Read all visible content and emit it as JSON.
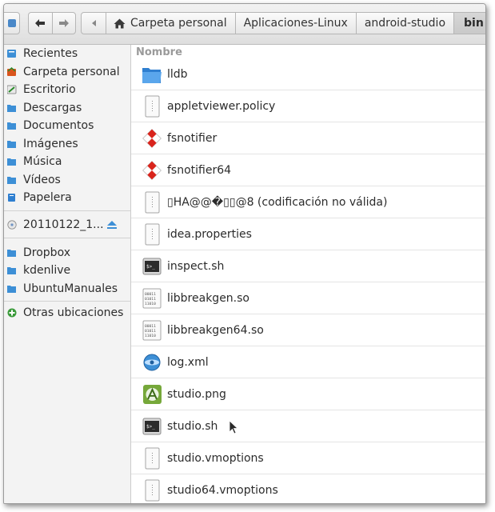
{
  "header": {
    "breadcrumbs": [
      {
        "label": "Carpeta personal",
        "icon": "home-icon"
      },
      {
        "label": "Aplicaciones-Linux"
      },
      {
        "label": "android-studio"
      },
      {
        "label": "bin",
        "active": true
      }
    ]
  },
  "sidebar": {
    "places": [
      {
        "label": "Recientes",
        "icon": "clock-icon"
      },
      {
        "label": "Carpeta personal",
        "icon": "home-icon"
      },
      {
        "label": "Escritorio",
        "icon": "desktop-icon"
      },
      {
        "label": "Descargas",
        "icon": "folder-icon"
      },
      {
        "label": "Documentos",
        "icon": "folder-icon"
      },
      {
        "label": "Imágenes",
        "icon": "folder-icon"
      },
      {
        "label": "Música",
        "icon": "folder-icon"
      },
      {
        "label": "Vídeos",
        "icon": "folder-icon"
      },
      {
        "label": "Papelera",
        "icon": "trash-icon"
      }
    ],
    "devices": [
      {
        "label": "20110122_1...",
        "icon": "disc-icon",
        "eject": true
      }
    ],
    "bookmarks": [
      {
        "label": "Dropbox",
        "icon": "folder-icon"
      },
      {
        "label": "kdenlive",
        "icon": "folder-icon"
      },
      {
        "label": "UbuntuManuales",
        "icon": "folder-icon"
      }
    ],
    "other": {
      "label": "Otras ubicaciones",
      "icon": "plus-icon"
    }
  },
  "list": {
    "column_header": "Nombre",
    "files": [
      {
        "name": "lldb",
        "icon": "folder-icon"
      },
      {
        "name": "appletviewer.policy",
        "icon": "text-file-icon"
      },
      {
        "name": "fsnotifier",
        "icon": "executable-icon"
      },
      {
        "name": "fsnotifier64",
        "icon": "executable-icon"
      },
      {
        "name": "▯HA@@�▯▯@8 (codificación no válida)",
        "icon": "text-file-icon"
      },
      {
        "name": "idea.properties",
        "icon": "text-file-icon"
      },
      {
        "name": "inspect.sh",
        "icon": "shell-script-icon"
      },
      {
        "name": "libbreakgen.so",
        "icon": "binary-file-icon"
      },
      {
        "name": "libbreakgen64.so",
        "icon": "binary-file-icon"
      },
      {
        "name": "log.xml",
        "icon": "xml-file-icon"
      },
      {
        "name": "studio.png",
        "icon": "image-file-icon"
      },
      {
        "name": "studio.sh",
        "icon": "shell-script-icon"
      },
      {
        "name": "studio.vmoptions",
        "icon": "text-file-icon"
      },
      {
        "name": "studio64.vmoptions",
        "icon": "text-file-icon"
      }
    ]
  },
  "colors": {
    "folder_blue": "#3d8fd6",
    "exec_red": "#d9241c",
    "sidebar_bg": "#f3f3f3"
  }
}
